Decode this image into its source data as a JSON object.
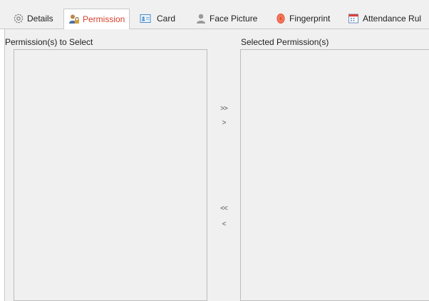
{
  "tabs": [
    {
      "label": "Details",
      "icon": "gear-icon"
    },
    {
      "label": "Permission",
      "icon": "user-lock-icon",
      "active": true
    },
    {
      "label": "Card",
      "icon": "card-icon"
    },
    {
      "label": "Face Picture",
      "icon": "person-silhouette-icon"
    },
    {
      "label": "Fingerprint",
      "icon": "fingerprint-icon"
    },
    {
      "label": "Attendance Rul",
      "icon": "calendar-icon"
    }
  ],
  "permission_panel": {
    "left_title": "Permission(s) to Select",
    "right_title": "Selected Permission(s)",
    "buttons": {
      "add_all": ">>",
      "add_one": ">",
      "remove_all": "<<",
      "remove_one": "<"
    }
  },
  "colors": {
    "active_tab_text": "#d6402c",
    "panel_background": "#f0f0f0",
    "border": "#bdbdbd"
  }
}
